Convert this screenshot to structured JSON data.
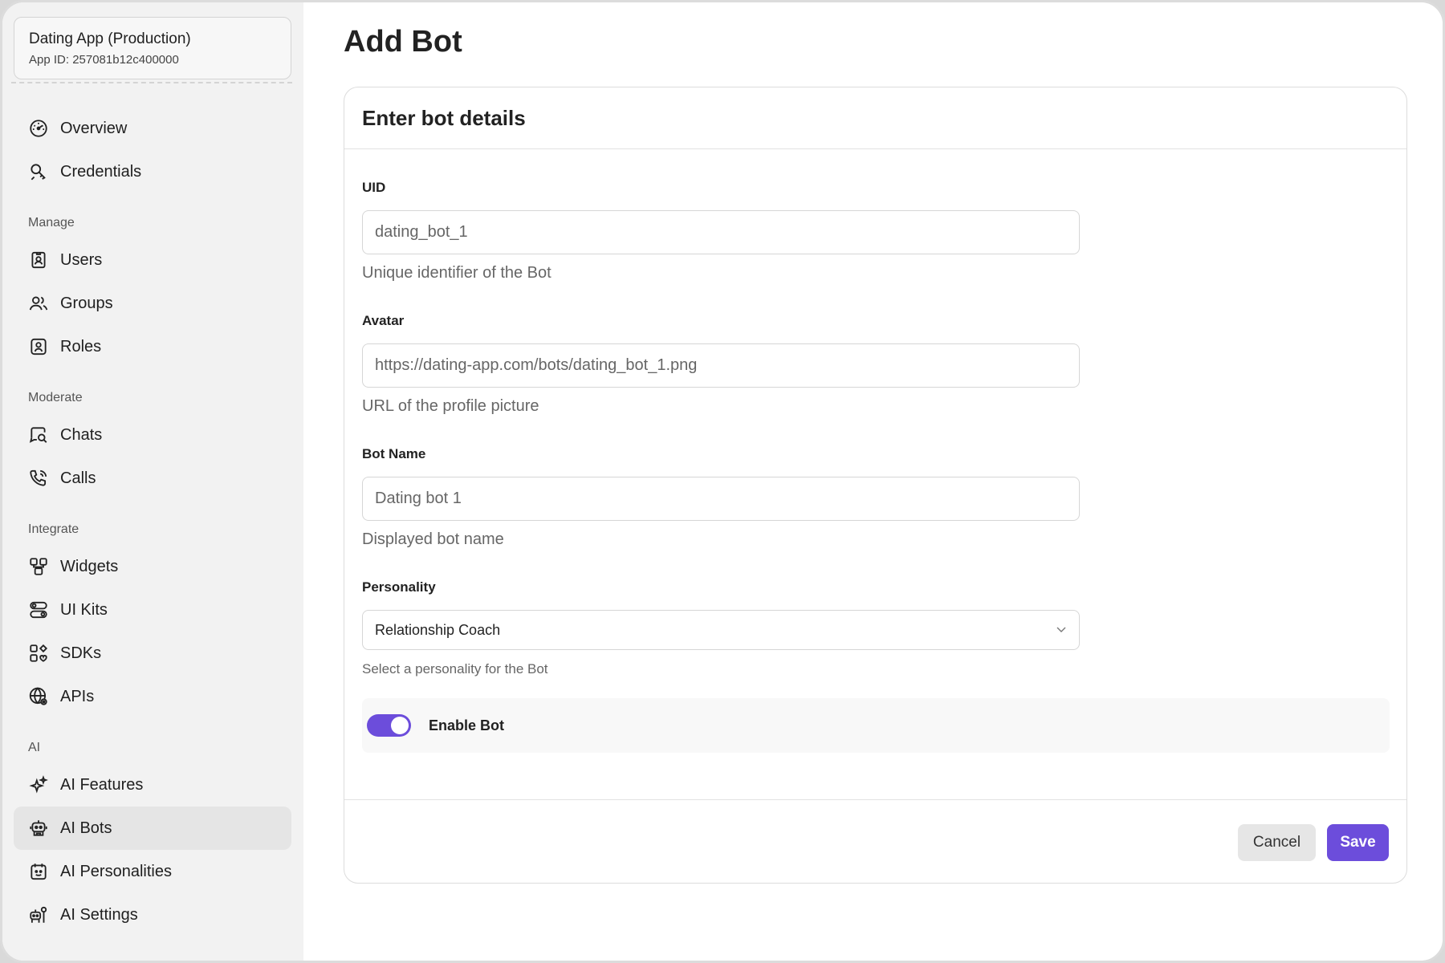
{
  "app": {
    "name": "Dating App (Production)",
    "id_label": "App ID: 257081b12c400000"
  },
  "sidebar": {
    "items_top": [
      {
        "label": "Overview",
        "icon": "dashboard-icon"
      },
      {
        "label": "Credentials",
        "icon": "key-icon"
      }
    ],
    "sections": [
      {
        "label": "Manage",
        "items": [
          {
            "label": "Users",
            "icon": "user-badge-icon"
          },
          {
            "label": "Groups",
            "icon": "group-icon"
          },
          {
            "label": "Roles",
            "icon": "shield-user-icon"
          }
        ]
      },
      {
        "label": "Moderate",
        "items": [
          {
            "label": "Chats",
            "icon": "chat-search-icon"
          },
          {
            "label": "Calls",
            "icon": "phone-icon"
          }
        ]
      },
      {
        "label": "Integrate",
        "items": [
          {
            "label": "Widgets",
            "icon": "widgets-icon"
          },
          {
            "label": "UI Kits",
            "icon": "toggles-icon"
          },
          {
            "label": "SDKs",
            "icon": "sdk-icon"
          },
          {
            "label": "APIs",
            "icon": "globe-icon"
          }
        ]
      },
      {
        "label": "AI",
        "items": [
          {
            "label": "AI Features",
            "icon": "sparkle-icon"
          },
          {
            "label": "AI Bots",
            "icon": "robot-icon",
            "active": true
          },
          {
            "label": "AI Personalities",
            "icon": "calendar-face-icon"
          },
          {
            "label": "AI Settings",
            "icon": "robot-settings-icon"
          }
        ]
      }
    ]
  },
  "page": {
    "title": "Add Bot",
    "card_title": "Enter bot details"
  },
  "form": {
    "uid": {
      "label": "UID",
      "value": "dating_bot_1",
      "help": "Unique identifier of the Bot"
    },
    "avatar": {
      "label": "Avatar",
      "value": "https://dating-app.com/bots/dating_bot_1.png",
      "help": "URL of the profile picture"
    },
    "bot_name": {
      "label": "Bot Name",
      "value": "Dating bot 1",
      "help": "Displayed bot name"
    },
    "personality": {
      "label": "Personality",
      "value": "Relationship Coach",
      "help": "Select a personality for the Bot"
    },
    "enable": {
      "label": "Enable Bot",
      "on": true
    }
  },
  "actions": {
    "cancel": "Cancel",
    "save": "Save"
  },
  "colors": {
    "accent": "#6c4ddb",
    "sidebar_bg": "#f2f2f2"
  }
}
